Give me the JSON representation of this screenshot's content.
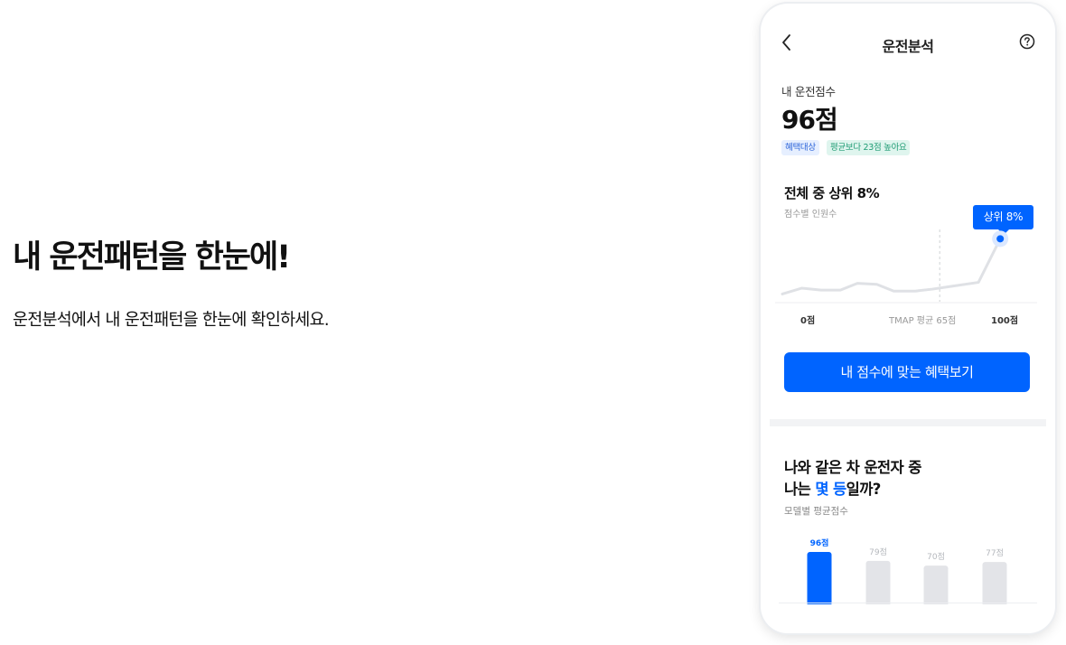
{
  "promo": {
    "title": "내 운전패턴을 한눈에!",
    "subtitle": "운전분석에서 내 운전패턴을 한눈에 확인하세요."
  },
  "app": {
    "header": {
      "title": "운전분석",
      "back_icon": "chevron-left-icon",
      "help_icon": "question-circle-icon"
    },
    "score": {
      "label": "내 운전점수",
      "value": "96점",
      "badges": [
        "혜택대상",
        "평균보다 23점 높아요"
      ]
    },
    "rank": {
      "title": "전체 중 상위 8%",
      "subtitle": "점수별 인원수",
      "tooltip": "상위 8%",
      "axis": {
        "min": "0점",
        "avg": "TMAP 평균 65점",
        "max": "100점"
      }
    },
    "cta_label": "내 점수에 맞는 혜택보기",
    "model": {
      "title_line1": "나와 같은 차 운전자 중",
      "title_prefix": "나는 ",
      "title_highlight": "몇 등",
      "title_suffix": "일까?",
      "subtitle": "모델별 평균점수"
    },
    "colors": {
      "accent": "#0064ff",
      "bar_muted": "#e3e4e8",
      "line": "#dfe1e5"
    }
  },
  "chart_data": [
    {
      "type": "line",
      "x": [
        0,
        8,
        16,
        24,
        31,
        39,
        46,
        55,
        62,
        70,
        81,
        90
      ],
      "y": [
        8,
        14,
        12,
        12,
        19,
        18,
        11,
        11,
        13,
        16,
        20,
        65
      ],
      "highlight": {
        "x": 90,
        "label": "상위 8%"
      },
      "avg_line": 65,
      "xlim": [
        0,
        100
      ]
    },
    {
      "type": "bar",
      "categories": [
        "",
        "",
        "",
        ""
      ],
      "values": [
        96,
        79,
        70,
        77
      ],
      "labels": [
        "96점",
        "79점",
        "70점",
        "77점"
      ],
      "highlight_index": 0
    }
  ]
}
